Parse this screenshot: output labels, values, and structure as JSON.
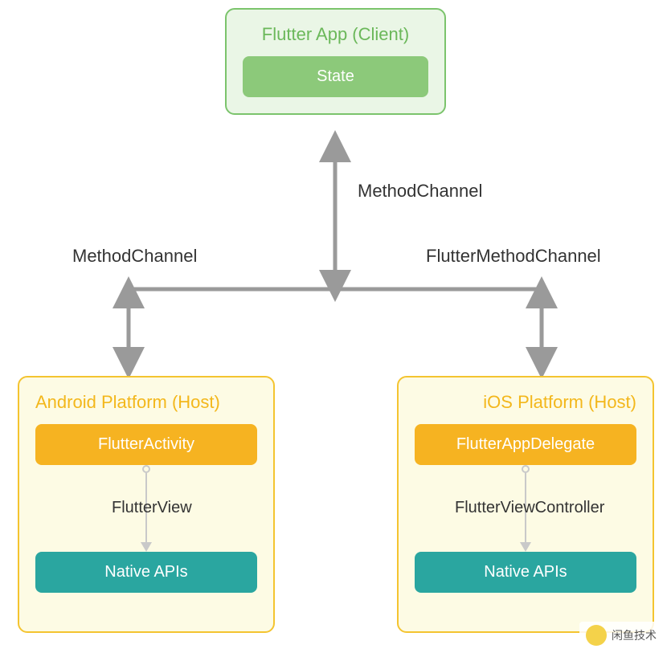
{
  "client": {
    "title": "Flutter App (Client)",
    "state_label": "State"
  },
  "edges": {
    "center": "MethodChannel",
    "left": "MethodChannel",
    "right": "FlutterMethodChannel"
  },
  "android": {
    "title": "Android Platform (Host)",
    "activity": "FlutterActivity",
    "view": "FlutterView",
    "native": "Native APIs"
  },
  "ios": {
    "title": "iOS Platform (Host)",
    "delegate": "FlutterAppDelegate",
    "controller": "FlutterViewController",
    "native": "Native APIs"
  },
  "watermark": "闲鱼技术"
}
